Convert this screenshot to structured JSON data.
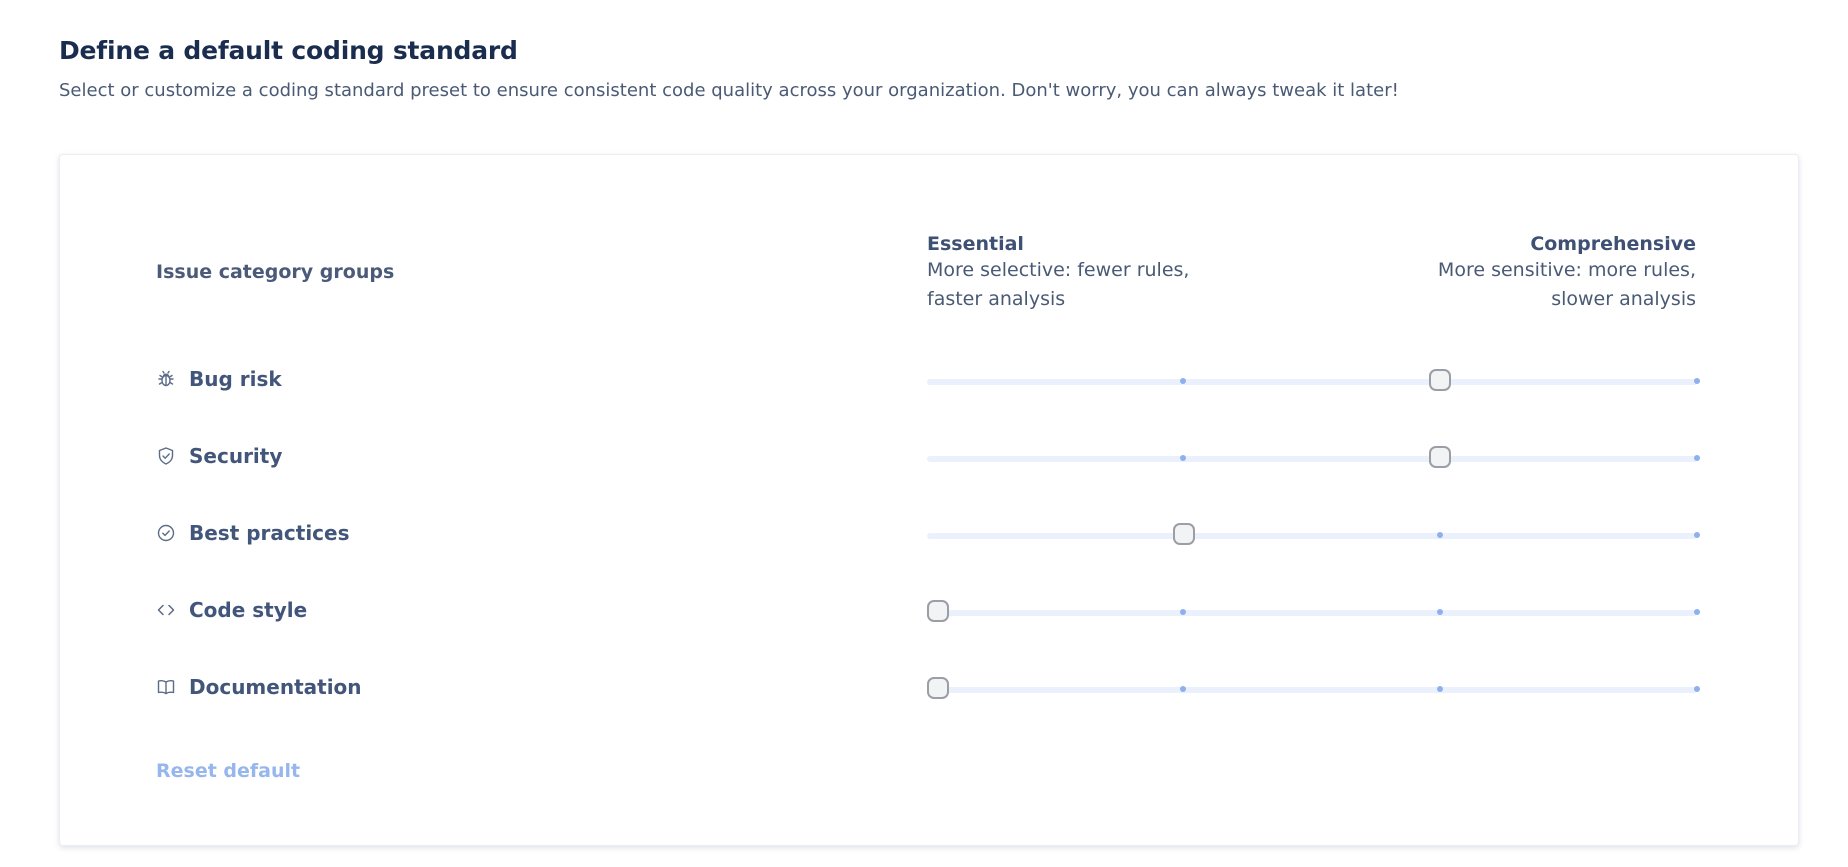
{
  "header": {
    "title": "Define a default coding standard",
    "subtitle": "Select or customize a coding standard preset to ensure consistent code quality across your organization. Don't worry, you can always tweak it later!"
  },
  "table": {
    "column_header": "Issue category groups",
    "levels": {
      "left_name": "Essential",
      "left_desc_1": "More selective: fewer rules,",
      "left_desc_2": "faster analysis",
      "right_name": "Comprehensive",
      "right_desc_1": "More sensitive: more rules,",
      "right_desc_2": "slower analysis"
    },
    "step_count": 4,
    "rows": [
      {
        "label": "Bug risk",
        "icon": "bug-icon",
        "level": 3
      },
      {
        "label": "Security",
        "icon": "shield-check-icon",
        "level": 3
      },
      {
        "label": "Best practices",
        "icon": "check-circle-icon",
        "level": 2
      },
      {
        "label": "Code style",
        "icon": "code-brackets-icon",
        "level": 1
      },
      {
        "label": "Documentation",
        "icon": "book-open-icon",
        "level": 1
      }
    ]
  },
  "actions": {
    "reset_label": "Reset default"
  },
  "colors": {
    "track": "#eaf0fc",
    "tick": "#8fb0ee",
    "link": "#97b6ee",
    "title": "#1b2d4f"
  }
}
